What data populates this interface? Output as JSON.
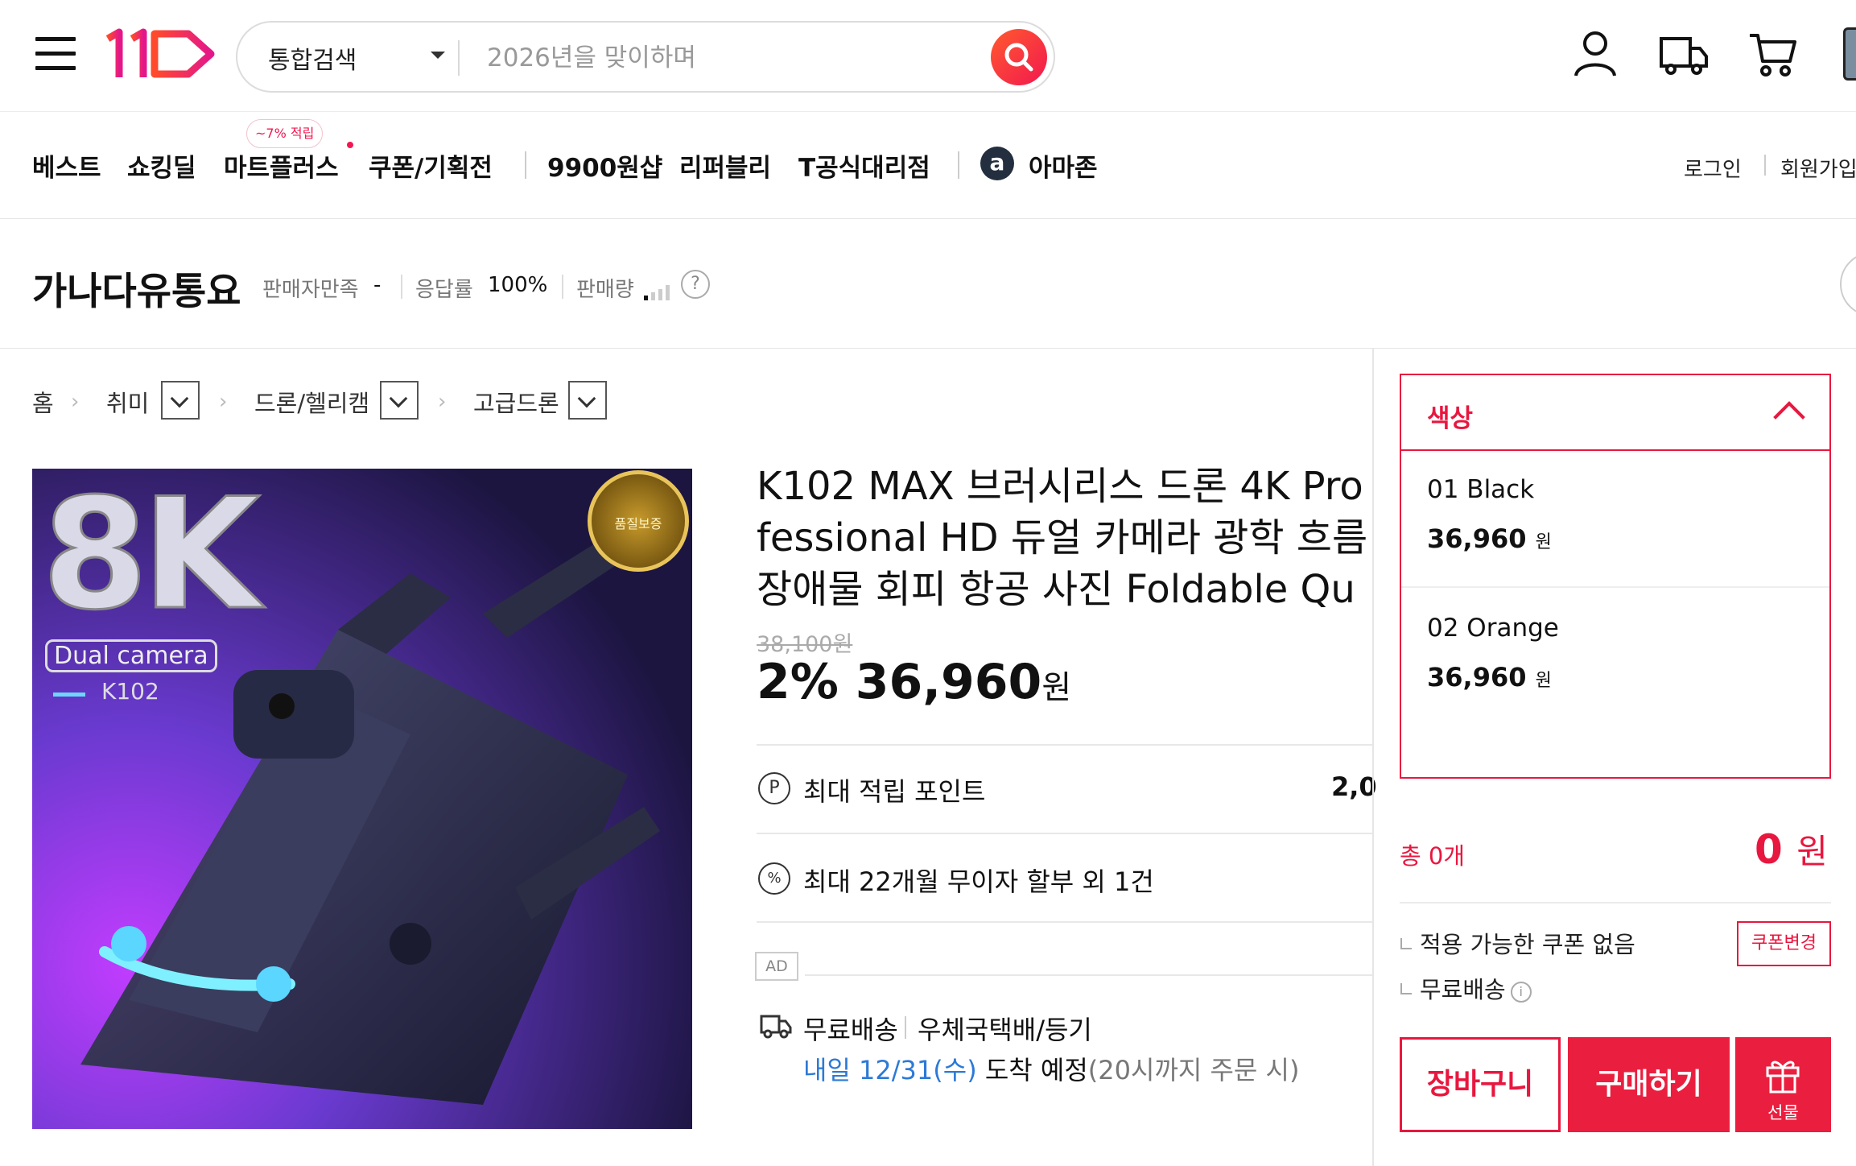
{
  "header": {
    "logo_text": "11",
    "search_scope": "통합검색",
    "search_placeholder": "2026년을 맞이하며"
  },
  "nav": {
    "items": [
      "베스트",
      "쇼킹딜",
      "마트플러스",
      "쿠폰/기획전",
      "9900원샵",
      "리퍼블리",
      "T공식대리점",
      "아마존"
    ],
    "badge": "~7% 적립",
    "amazon_glyph": "a",
    "login": "로그인",
    "signup": "회원가입"
  },
  "seller": {
    "name": "가나다유통요",
    "satisfaction_label": "판매자만족",
    "satisfaction_value": "-",
    "response_label": "응답률",
    "response_value": "100%",
    "sales_label": "판매량",
    "help": "?"
  },
  "breadcrumb": [
    "홈",
    "취미",
    "드론/헬리캠",
    "고급드론"
  ],
  "product": {
    "image_text": {
      "big": "8K",
      "dual": "Dual camera",
      "model": "K102",
      "seal": "품질보증"
    },
    "title": "K102 MAX 브러시리스 드론 4K Professional HD 듀얼 카메라 광학 흐름 장애물 회피 항공 사진 Foldable Quad",
    "original_price": "38,100원",
    "discount": "2%",
    "price": "36,960",
    "price_unit": "원",
    "points_label": "최대 적립 포인트",
    "points_value": "2,0",
    "points_icon": "P",
    "installment_label": "최대 22개월 무이자 할부 외 1건",
    "installment_icon": "%",
    "ad": "AD",
    "shipping_free": "무료배송",
    "shipping_carrier": "우체국택배/등기",
    "delivery_date": "내일 12/31(수)",
    "delivery_arrive": "도착 예정",
    "delivery_note": "(20시까지 주문 시)"
  },
  "options": {
    "header": "색상",
    "items": [
      {
        "name": "01 Black",
        "price": "36,960",
        "unit": "원"
      },
      {
        "name": "02 Orange",
        "price": "36,960",
        "unit": "원"
      }
    ]
  },
  "summary": {
    "total_label": "총 0개",
    "total_value": "0",
    "total_unit": "원",
    "coupon_none": "적용 가능한 쿠폰 없음",
    "coupon_change": "쿠폰변경",
    "free_shipping": "무료배송",
    "info": "i",
    "cart": "장바구니",
    "buy": "구매하기",
    "gift": "선물"
  },
  "colors": {
    "brand_red": "#e8173f",
    "link_blue": "#2c7ad6"
  }
}
